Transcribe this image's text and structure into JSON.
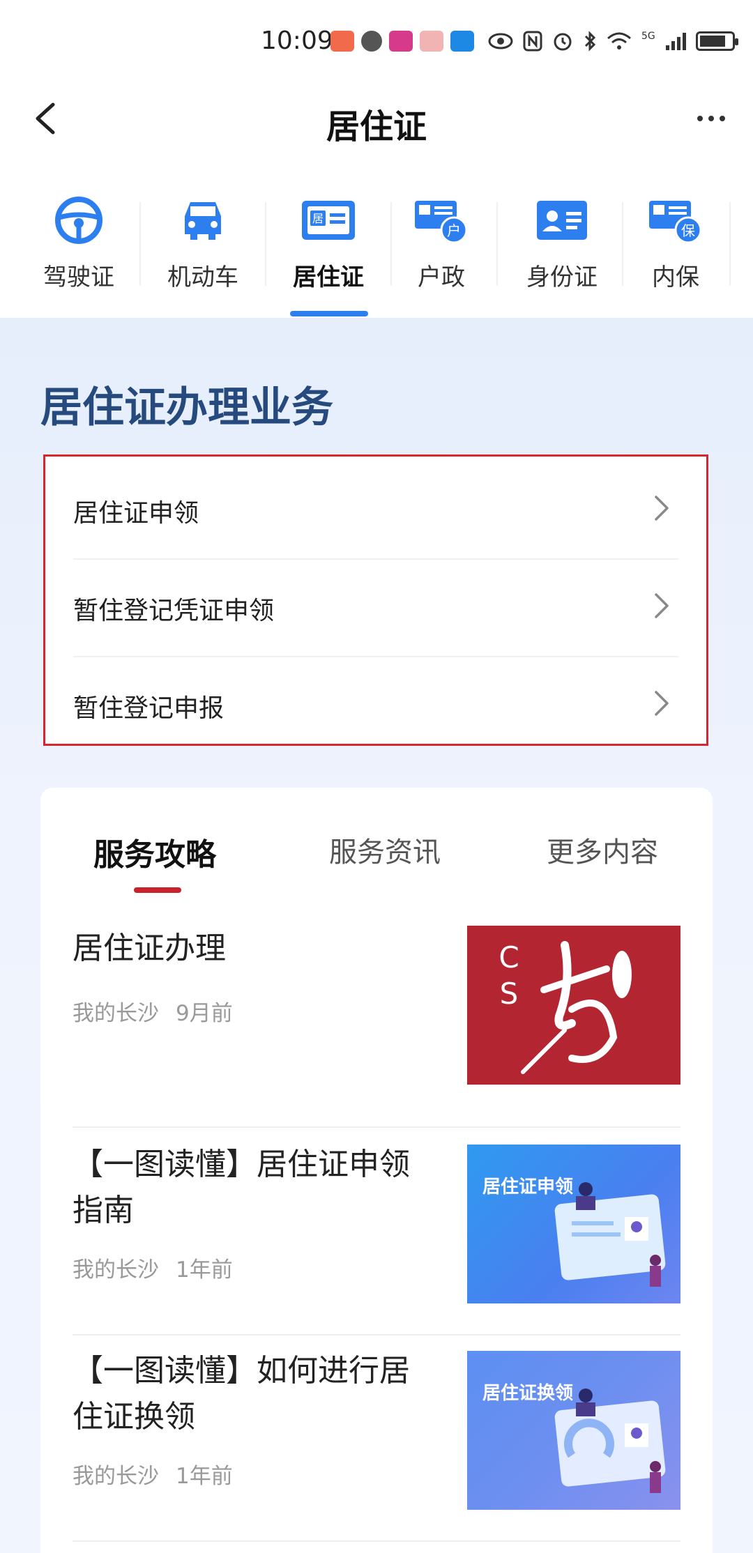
{
  "status_bar": {
    "time": "10:09",
    "network": "5G",
    "icons": [
      "vivo-icon",
      "message-icon",
      "app-icon",
      "gift-icon",
      "bookmark-icon",
      "eye-icon",
      "nfc-icon",
      "alarm-icon",
      "bluetooth-icon",
      "wifi-icon",
      "signal-icon",
      "battery-icon"
    ]
  },
  "header": {
    "title": "居住证"
  },
  "categories": [
    {
      "label": "驾驶证",
      "icon": "steering-wheel-icon"
    },
    {
      "label": "机动车",
      "icon": "car-icon"
    },
    {
      "label": "居住证",
      "icon": "residence-card-icon",
      "active": true
    },
    {
      "label": "户政",
      "icon": "household-icon"
    },
    {
      "label": "身份证",
      "icon": "id-card-icon"
    },
    {
      "label": "内保",
      "icon": "security-icon"
    }
  ],
  "section": {
    "title": "居住证办理业务",
    "items": [
      {
        "label": "居住证申领"
      },
      {
        "label": "暂住登记凭证申领"
      },
      {
        "label": "暂住登记申报"
      }
    ]
  },
  "news": {
    "tabs": [
      "服务攻略",
      "服务资讯",
      "更多内容"
    ],
    "active_tab": 0,
    "articles": [
      {
        "title": "居住证办理",
        "source": "我的长沙",
        "time": "9月前",
        "thumb_caption": ""
      },
      {
        "title": "【一图读懂】居住证申领指南",
        "source": "我的长沙",
        "time": "1年前",
        "thumb_caption": "居住证申领"
      },
      {
        "title": "【一图读懂】如何进行居住证换领",
        "source": "我的长沙",
        "time": "1年前",
        "thumb_caption": "居住证换领"
      }
    ]
  },
  "colors": {
    "accent_blue": "#2d7ff0",
    "section_title": "#274a7e",
    "highlight_red": "#d6262f",
    "tab_underline_red": "#c8222c"
  }
}
